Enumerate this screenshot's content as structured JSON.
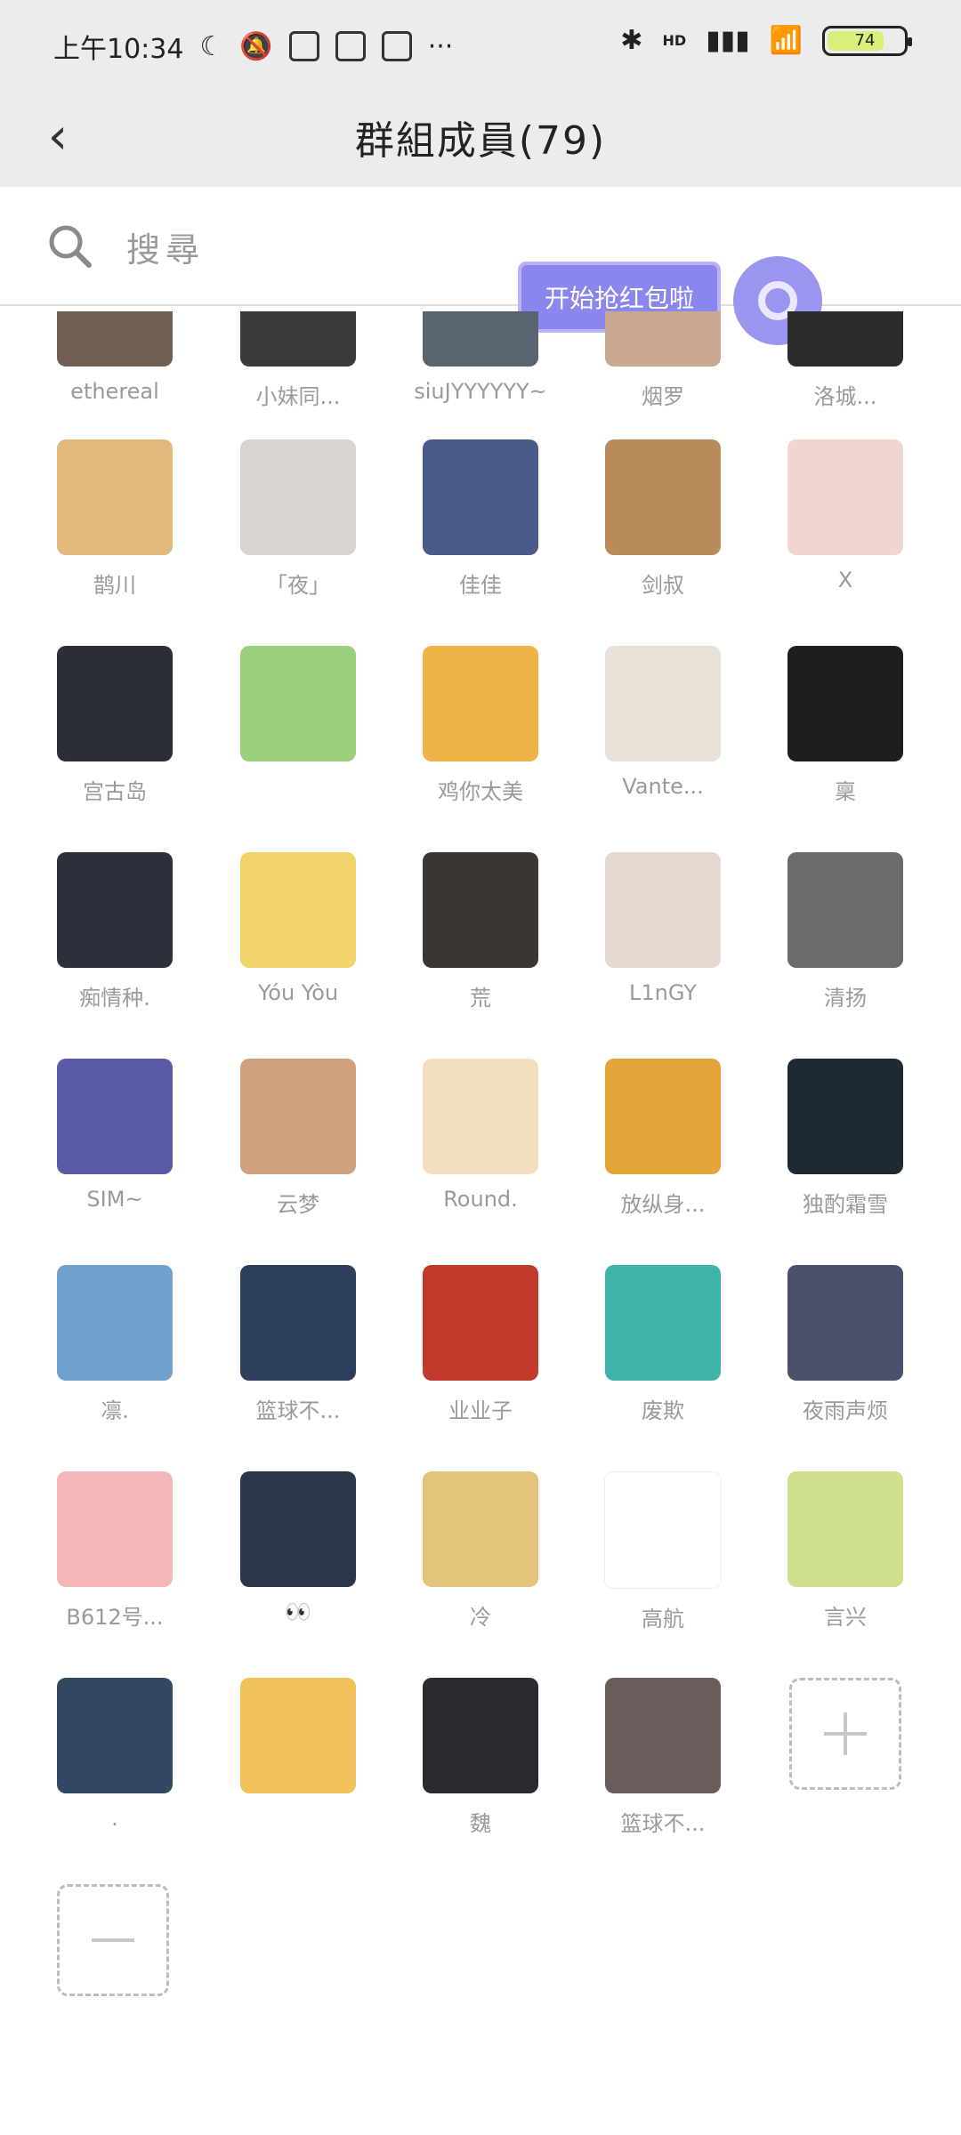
{
  "status_bar": {
    "time": "上午10:34",
    "more": "···",
    "network": "HD",
    "battery": "74"
  },
  "header": {
    "back_icon": "chevron-left-icon",
    "title": "群組成員(79)"
  },
  "search": {
    "placeholder": "搜尋",
    "icon": "search-icon"
  },
  "floating": {
    "label": "开始抢红包啦"
  },
  "members": [
    {
      "name": "ethereal",
      "color": "#6f5f52"
    },
    {
      "name": "小妹同...",
      "color": "#3a3a3a"
    },
    {
      "name": "siuJYYYYYY~",
      "color": "#5a6370"
    },
    {
      "name": "烟罗",
      "color": "#c8a890"
    },
    {
      "name": "洛城...",
      "color": "#2b2b2b"
    },
    {
      "name": "鹊川",
      "color": "#e3b87c"
    },
    {
      "name": "「夜」",
      "color": "#d9d4d2"
    },
    {
      "name": "佳佳",
      "color": "#4a5a88"
    },
    {
      "name": "剑叔",
      "color": "#b98a5a"
    },
    {
      "name": "X",
      "color": "#f1d5cf"
    },
    {
      "name": "宫古岛",
      "color": "#2a2e36"
    },
    {
      "name": "",
      "color": "#9bd07a"
    },
    {
      "name": "鸡你太美",
      "color": "#f0b34a"
    },
    {
      "name": "Vante...",
      "color": "#e8e2d8"
    },
    {
      "name": "稟",
      "color": "#1e1e1e"
    },
    {
      "name": "痴情种.",
      "color": "#2d2f3a"
    },
    {
      "name": "Yóu Yòu",
      "color": "#f2d36b"
    },
    {
      "name": "荒",
      "color": "#3b3532"
    },
    {
      "name": "L1nGY",
      "color": "#e7d8d2"
    },
    {
      "name": "清扬",
      "color": "#6b6b6b"
    },
    {
      "name": "SIM~",
      "color": "#5b5aa6"
    },
    {
      "name": "云梦",
      "color": "#d1a17f"
    },
    {
      "name": "Round.",
      "color": "#f3dfc0"
    },
    {
      "name": "放纵身...",
      "color": "#e3a53a"
    },
    {
      "name": "独酌霜雪",
      "color": "#1d2a33"
    },
    {
      "name": "凛.",
      "color": "#6fa1cc"
    },
    {
      "name": "篮球不...",
      "color": "#2c3e5a"
    },
    {
      "name": "业业子",
      "color": "#c0392b"
    },
    {
      "name": "废欺",
      "color": "#3fb3a8"
    },
    {
      "name": "夜雨声烦",
      "color": "#4a4f6b"
    },
    {
      "name": "B612号...",
      "color": "#f3b7b7"
    },
    {
      "name": "👀",
      "color": "#2a3748"
    },
    {
      "name": "冷",
      "color": "#e3c47a"
    },
    {
      "name": "高航",
      "color": "#ffffff"
    },
    {
      "name": "言兴",
      "color": "#cfe08c"
    },
    {
      "name": ".",
      "color": "#324760"
    },
    {
      "name": "",
      "color": "#f0c05a"
    },
    {
      "name": "魏",
      "color": "#2a2a2e"
    },
    {
      "name": "篮球不...",
      "color": "#6b5b5b"
    }
  ]
}
